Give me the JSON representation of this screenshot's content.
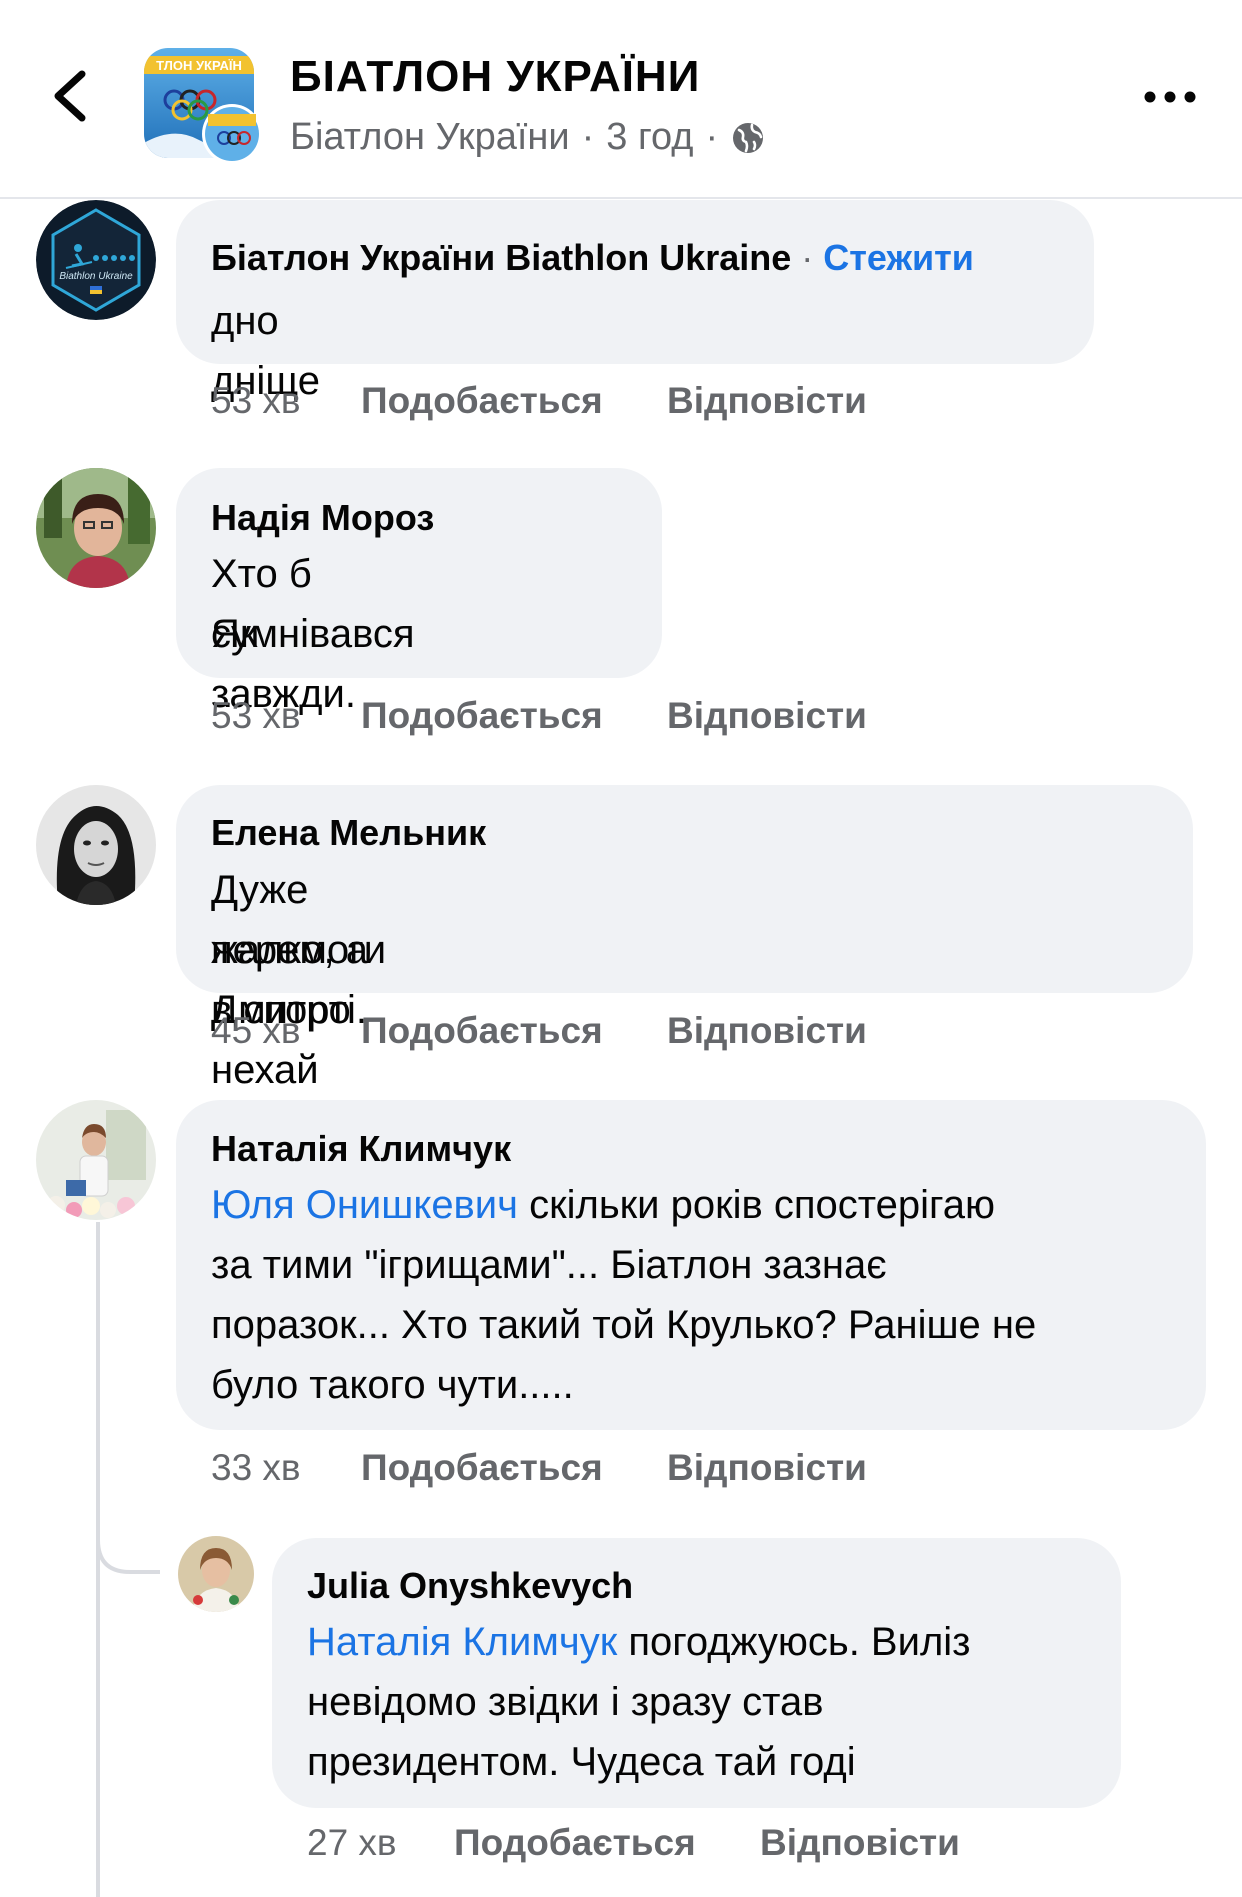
{
  "header": {
    "title": "БІАТЛОН УКРАЇНИ",
    "subtitle_name": "Біатлон України",
    "subtitle_sep1": "·",
    "subtitle_time": "3 год",
    "subtitle_sep2": "·",
    "avatar_text": "ТЛОН УКРАЇН"
  },
  "comments": [
    {
      "author": "Біатлон України Biathlon Ukraine",
      "sep": "·",
      "follow": "Стежити",
      "text": "дно дніще",
      "time": "53 хв",
      "like": "Подобається",
      "reply": "Відповісти",
      "avatar_text": "Biathlon Ukraine"
    },
    {
      "author": "Надія Мороз",
      "line1": "Хто б сумнівався ...",
      "line2": "Як завжди.",
      "time": "53 хв",
      "like": "Подобається",
      "reply": "Відповісти"
    },
    {
      "author": "Елена Мельник",
      "line1": "Дуже жалко, а Дмитро нехай одержить нові",
      "line2": "перемоги в спорті.",
      "time": "45 хв",
      "like": "Подобається",
      "reply": "Відповісти"
    },
    {
      "author": "Наталія Климчук",
      "mention": "Юля Онишкевич",
      "line1_rest": " скільки років спостерігаю",
      "line2": "за тими \"ігрищами\"... Біатлон зазнає",
      "line3": "поразок... Хто такий той Крулько? Раніше не",
      "line4": "було такого чути.....",
      "time": "33 хв",
      "like": "Подобається",
      "reply": "Відповісти"
    },
    {
      "author": "Julia Onyshkevych",
      "mention": "Наталія Климчук",
      "line1_rest": " погоджуюсь. Виліз",
      "line2": "невідомо звідки і зразу став",
      "line3": "президентом. Чудеса тай годі",
      "time": "27 хв",
      "like": "Подобається",
      "reply": "Відповісти"
    }
  ],
  "colors": {
    "accent": "#1b74e4",
    "bubble": "#f0f2f5",
    "secondary_text": "#65676b"
  }
}
